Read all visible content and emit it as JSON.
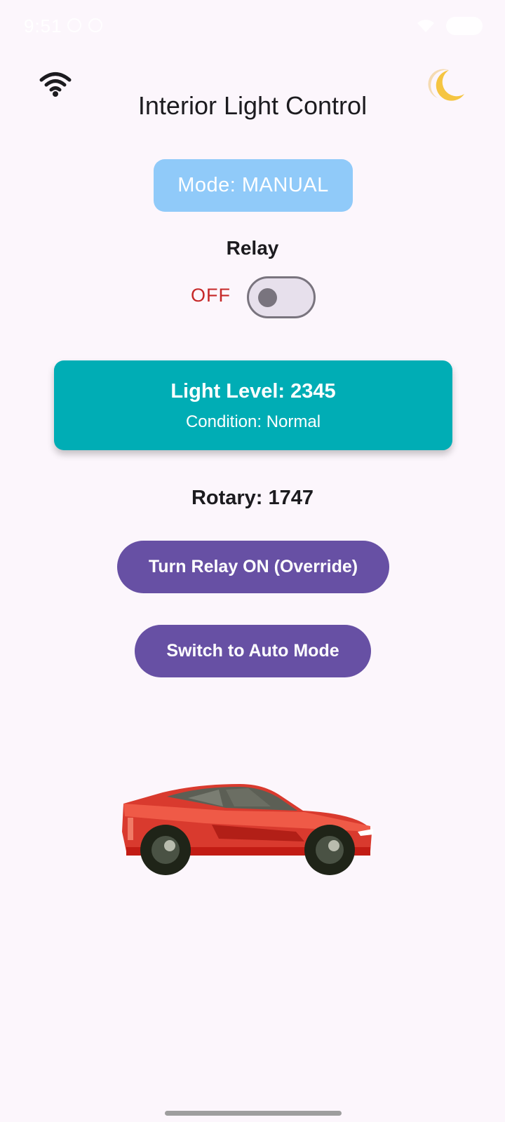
{
  "status_bar": {
    "time": "9:51"
  },
  "header": {
    "title": "Interior Light Control",
    "wifi_icon": "wifi-icon",
    "theme_icon": "moon-icon"
  },
  "mode": {
    "label": "Mode: MANUAL",
    "color": "#90caf9"
  },
  "relay": {
    "label": "Relay",
    "state": "OFF",
    "state_color": "#c62828",
    "switch_on": false
  },
  "light_card": {
    "level": "Light Level: 2345",
    "condition": "Condition: Normal",
    "color": "#00adb5"
  },
  "rotary": {
    "text": "Rotary: 1747"
  },
  "buttons": {
    "override": "Turn Relay ON (Override)",
    "auto_mode": "Switch to Auto Mode",
    "color": "#6750a4"
  },
  "illustration": {
    "icon": "car-icon"
  }
}
